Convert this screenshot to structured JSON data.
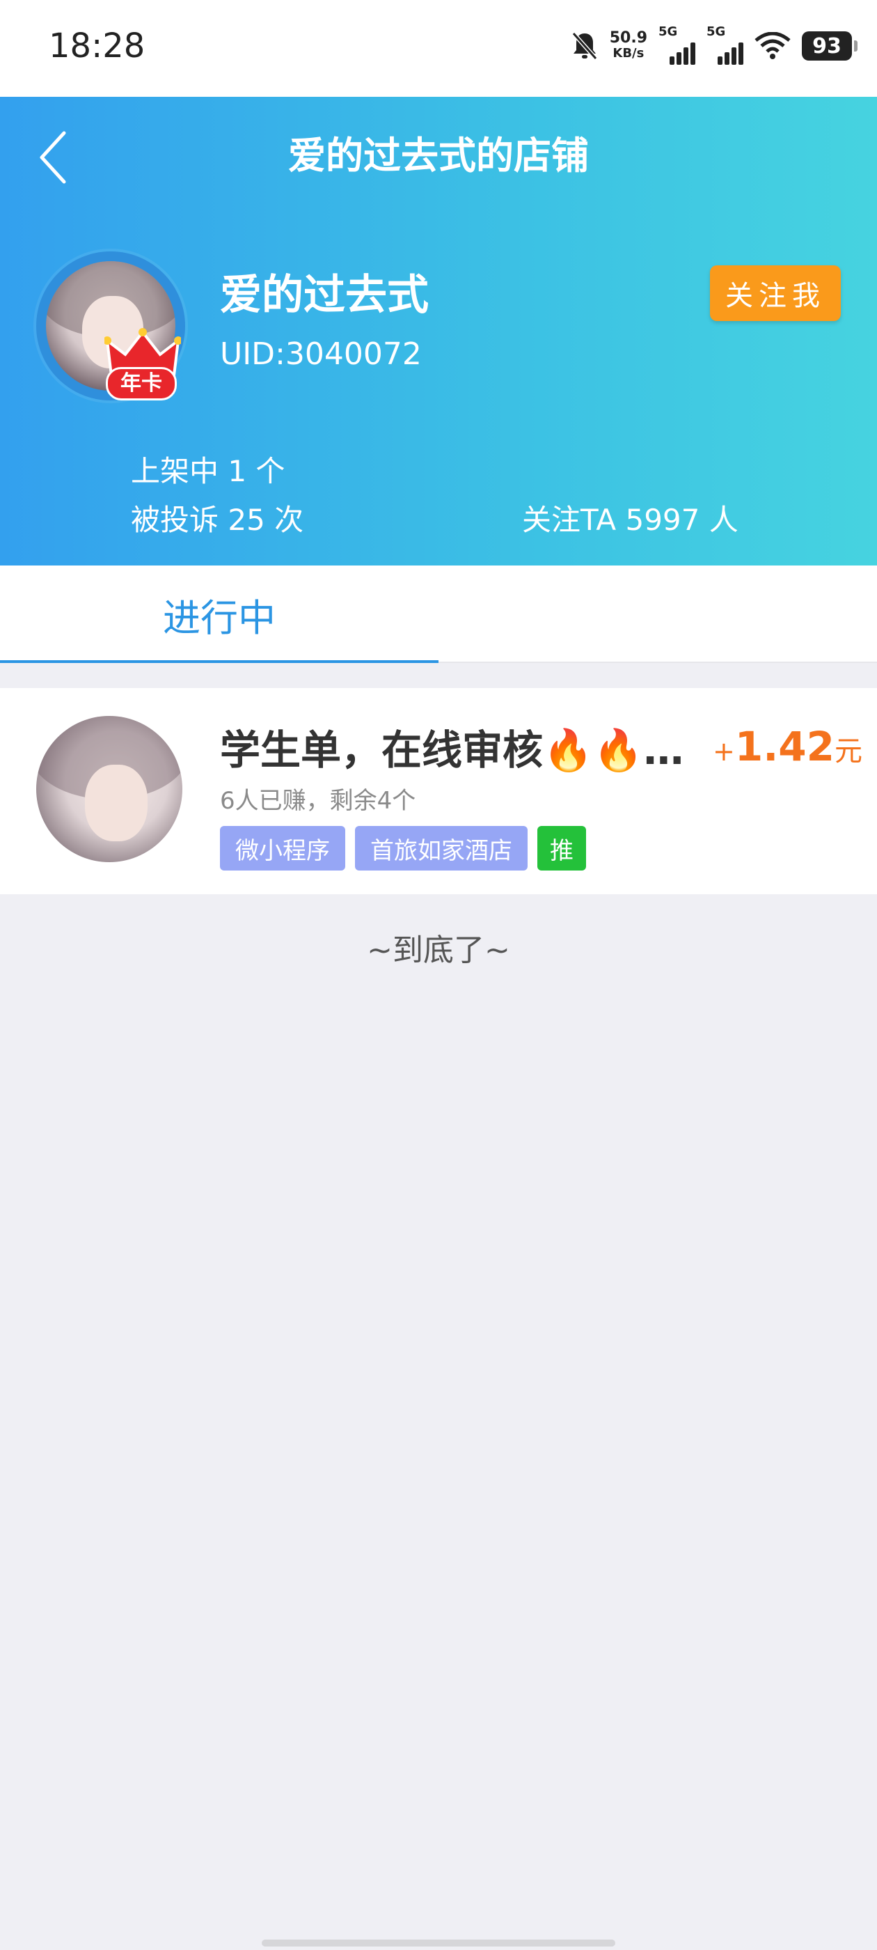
{
  "status_bar": {
    "time": "18:28",
    "net_speed_value": "50.9",
    "net_speed_unit": "KB/s",
    "sim1": "5G",
    "sim2": "5G",
    "battery": "93",
    "icons": [
      "bell-muted-icon",
      "signal-icon",
      "signal-icon",
      "wifi-icon",
      "battery-icon"
    ]
  },
  "header": {
    "title": "爱的过去式的店铺",
    "back_icon": "chevron-left-icon",
    "shop_name": "爱的过去式",
    "uid": "UID:3040072",
    "badge": "年卡",
    "follow_label": "关注我",
    "stats": {
      "listed": "上架中 1 个",
      "complaints": "被投诉 25 次",
      "followers": "关注TA 5997 人"
    },
    "gradient_colors": [
      "#33a0ee",
      "#46d3e0"
    ]
  },
  "tabs": [
    {
      "label": "进行中",
      "active": true
    }
  ],
  "tasks": [
    {
      "title": "学生单，在线审核🔥🔥…",
      "reward_prefix": "+",
      "reward_amount": "1.42",
      "reward_unit": "元",
      "meta": "6人已赚，剩余4个",
      "tags": [
        "微小程序",
        "首旅如家酒店",
        "推"
      ]
    }
  ],
  "end_text": "~到底了~",
  "colors": {
    "accent": "#2b95e3",
    "follow_button": "#fa9a1b",
    "reward": "#f4721c",
    "tag": "#96a6f5",
    "tag_green": "#24c13a"
  }
}
